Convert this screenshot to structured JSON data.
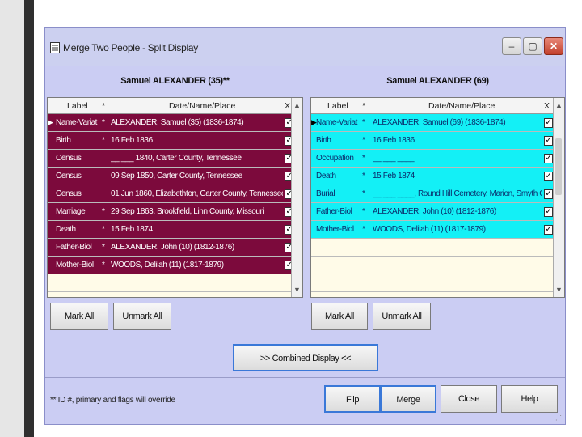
{
  "window": {
    "title": "Merge Two People - Split Display",
    "minimize_glyph": "‒",
    "maximize_glyph": "▢",
    "close_glyph": "✕"
  },
  "left": {
    "person": "Samuel ALEXANDER (35)**",
    "headers": {
      "label": "Label",
      "star": "*",
      "dnp": "Date/Name/Place",
      "x": "X"
    },
    "rows": [
      {
        "label": "Name-Variat",
        "star": "*",
        "dnp": "ALEXANDER, Samuel (35) (1836-1874)",
        "checked": true
      },
      {
        "label": "Birth",
        "star": "*",
        "dnp": "16 Feb 1836",
        "checked": true
      },
      {
        "label": "Census",
        "star": "",
        "dnp": "__ ___ 1840, Carter County, Tennessee",
        "checked": true
      },
      {
        "label": "Census",
        "star": "",
        "dnp": "09 Sep 1850, Carter County, Tennessee",
        "checked": true
      },
      {
        "label": "Census",
        "star": "",
        "dnp": "01 Jun 1860, Elizabethton, Carter County, Tennessee",
        "checked": true
      },
      {
        "label": "Marriage",
        "star": "*",
        "dnp": "29 Sep 1863, Brookfield, Linn County, Missouri",
        "checked": true
      },
      {
        "label": "Death",
        "star": "*",
        "dnp": "15 Feb 1874",
        "checked": true
      },
      {
        "label": "Father-Biol",
        "star": "*",
        "dnp": "ALEXANDER, John (10) (1812-1876)",
        "checked": true
      },
      {
        "label": "Mother-Biol",
        "star": "*",
        "dnp": "WOODS, Delilah (11) (1817-1879)",
        "checked": true
      }
    ],
    "mark_all": "Mark All",
    "unmark_all": "Unmark All"
  },
  "right": {
    "person": "Samuel ALEXANDER (69)",
    "headers": {
      "label": "Label",
      "star": "*",
      "dnp": "Date/Name/Place",
      "x": "X"
    },
    "rows": [
      {
        "label": "Name-Variat",
        "star": "*",
        "dnp": "ALEXANDER, Samuel (69) (1836-1874)",
        "checked": true
      },
      {
        "label": "Birth",
        "star": "*",
        "dnp": "16 Feb 1836",
        "checked": true
      },
      {
        "label": "Occupation",
        "star": "*",
        "dnp": "__ ___ ____",
        "checked": true
      },
      {
        "label": "Death",
        "star": "*",
        "dnp": "15 Feb 1874",
        "checked": true
      },
      {
        "label": "Burial",
        "star": "*",
        "dnp": "__ ___ ____, Round Hill Cemetery, Marion, Smyth County",
        "checked": true
      },
      {
        "label": "Father-Biol",
        "star": "*",
        "dnp": "ALEXANDER, John (10) (1812-1876)",
        "checked": true
      },
      {
        "label": "Mother-Biol",
        "star": "*",
        "dnp": "WOODS, Delilah (11) (1817-1879)",
        "checked": true
      }
    ],
    "mark_all": "Mark All",
    "unmark_all": "Unmark All"
  },
  "combined_display": ">> Combined Display <<",
  "footnote": "** ID #, primary and flags will override",
  "buttons": {
    "flip": "Flip",
    "merge": "Merge",
    "close": "Close",
    "help": "Help"
  },
  "colors": {
    "left_row_bg": "#7c0a3c",
    "right_row_bg": "#13f0f6",
    "window_bg": "#cbcdf3",
    "empty_row_bg": "#fffbe8"
  }
}
